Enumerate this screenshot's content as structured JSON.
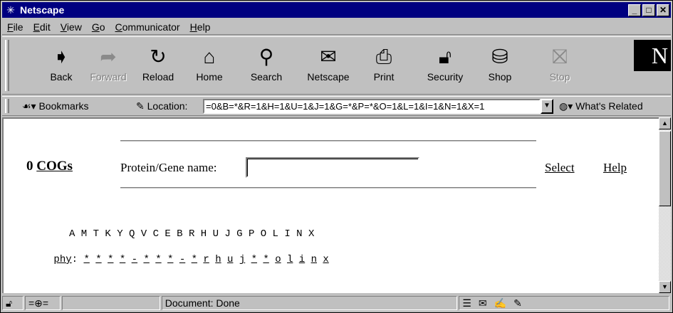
{
  "window": {
    "title": "Netscape"
  },
  "menu": [
    "File",
    "Edit",
    "View",
    "Go",
    "Communicator",
    "Help"
  ],
  "menu_accel": [
    "F",
    "E",
    "V",
    "G",
    "C",
    "H"
  ],
  "nav": {
    "back": "Back",
    "forward": "Forward",
    "reload": "Reload",
    "home": "Home",
    "search": "Search",
    "netscape": "Netscape",
    "print": "Print",
    "security": "Security",
    "shop": "Shop",
    "stop": "Stop"
  },
  "location": {
    "bookmarks": "Bookmarks",
    "label": "Location:",
    "value": "=0&B=*&R=1&H=1&U=1&J=1&G=*&P=*&O=1&L=1&I=1&N=1&X=1",
    "related": "What's Related"
  },
  "page": {
    "cogs_count": "0",
    "cogs_link": "COGs",
    "protein_label": "Protein/Gene name:",
    "protein_value": "",
    "select_link": "Select",
    "help_link": "Help",
    "letters": [
      "A",
      "M",
      "T",
      "K",
      "Y",
      "Q",
      "V",
      "C",
      "E",
      "B",
      "R",
      "H",
      "U",
      "J",
      "G",
      "P",
      "O",
      "L",
      "I",
      "N",
      "X"
    ],
    "phy_label": "phy",
    "phy_values": [
      "*",
      "*",
      "*",
      "*",
      "-",
      "*",
      "*",
      "*",
      "-",
      "*",
      "r",
      "h",
      "u",
      "j",
      "*",
      "*",
      "o",
      "l",
      "i",
      "n",
      "x"
    ]
  },
  "status": {
    "text": "Document: Done"
  }
}
